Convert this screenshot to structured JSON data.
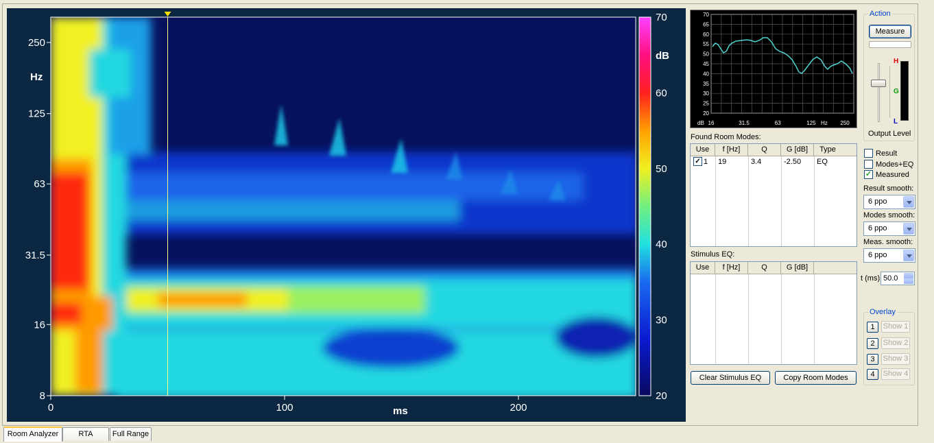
{
  "tabs": [
    {
      "label": "Room Analyzer",
      "active": true
    },
    {
      "label": "RTA",
      "active": false
    },
    {
      "label": "Full Range",
      "active": false
    }
  ],
  "spectrogram": {
    "y_ticks": [
      "250",
      "125",
      "63",
      "31.5",
      "16",
      "8"
    ],
    "y_unit": "Hz",
    "x_ticks": [
      "0",
      "100",
      "200"
    ],
    "x_unit": "ms",
    "colorbar_ticks": [
      "70",
      "60",
      "50",
      "40",
      "30",
      "20"
    ],
    "colorbar_unit": "dB",
    "cursor_time_ms": 50
  },
  "mini_plot": {
    "y_ticks": [
      "70",
      "65",
      "60",
      "55",
      "50",
      "45",
      "40",
      "35",
      "30",
      "25",
      "20"
    ],
    "x_ticks": [
      "16",
      "31.5",
      "63",
      "125",
      "250"
    ],
    "y_unit": "dB",
    "x_unit": "Hz",
    "line_color": "#4fd6d0"
  },
  "room_modes": {
    "title": "Found Room Modes:",
    "columns": [
      "Use",
      "f [Hz]",
      "Q",
      "G [dB]",
      "Type"
    ],
    "rows": [
      {
        "use": true,
        "index": "1",
        "f": "19",
        "q": "3.4",
        "g": "-2.50",
        "type": "EQ"
      }
    ]
  },
  "stimulus_eq": {
    "title": "Stimulus EQ:",
    "columns": [
      "Use",
      "f [Hz]",
      "Q",
      "G [dB]"
    ]
  },
  "buttons": {
    "clear_stimulus": "Clear Stimulus EQ",
    "copy_modes": "Copy Room Modes",
    "measure": "Measure"
  },
  "action": {
    "title": "Action",
    "output_level": "Output Level",
    "meter_h": "H",
    "meter_g": "G",
    "meter_l": "L"
  },
  "display": {
    "result": {
      "label": "Result",
      "checked": false
    },
    "modes_eq": {
      "label": "Modes+EQ",
      "checked": false
    },
    "measured": {
      "label": "Measured",
      "checked": true
    },
    "result_smooth": {
      "label": "Result smooth:",
      "value": "6 ppo"
    },
    "modes_smooth": {
      "label": "Modes smooth:",
      "value": "6 ppo"
    },
    "meas_smooth": {
      "label": "Meas. smooth:",
      "value": "6 ppo"
    },
    "t_label": "t (ms)",
    "t_value": "50.0"
  },
  "overlay": {
    "title": "Overlay",
    "items": [
      {
        "num": "1",
        "label": "Show 1"
      },
      {
        "num": "2",
        "label": "Show 2"
      },
      {
        "num": "3",
        "label": "Show 3"
      },
      {
        "num": "4",
        "label": "Show 4"
      }
    ]
  }
}
